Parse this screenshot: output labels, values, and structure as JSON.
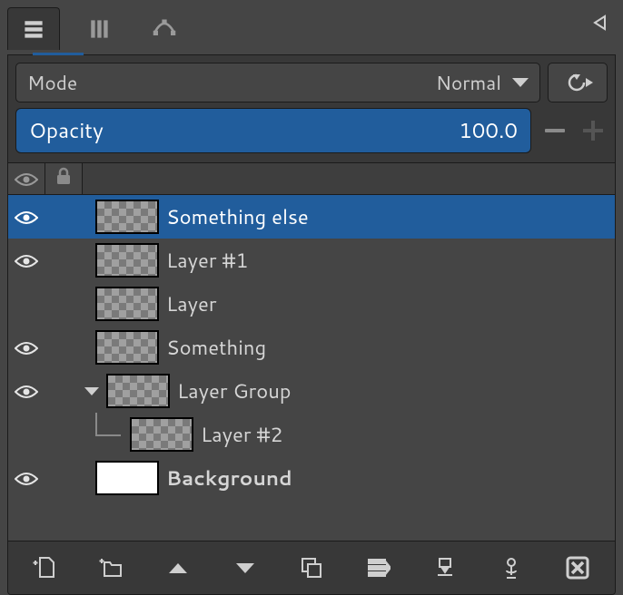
{
  "panelTabs": [
    "layers",
    "channels",
    "paths"
  ],
  "activeTab": "layers",
  "mode": {
    "label": "Mode",
    "value": "Normal"
  },
  "opacity": {
    "label": "Opacity",
    "value": "100.0"
  },
  "listHeader": {
    "visibility": "eye",
    "lock": "lock"
  },
  "layers": [
    {
      "name": "Something else",
      "visible": true,
      "selected": true,
      "thumb": "alpha",
      "indent": 0,
      "type": "layer"
    },
    {
      "name": "Layer #1",
      "visible": true,
      "selected": false,
      "thumb": "alpha",
      "indent": 0,
      "type": "layer"
    },
    {
      "name": "Layer",
      "visible": false,
      "selected": false,
      "thumb": "alpha",
      "indent": 0,
      "type": "layer"
    },
    {
      "name": "Something",
      "visible": true,
      "selected": false,
      "thumb": "alpha",
      "indent": 0,
      "type": "layer"
    },
    {
      "name": "Layer Group",
      "visible": true,
      "selected": false,
      "thumb": "alpha",
      "indent": 0,
      "type": "group",
      "expanded": true
    },
    {
      "name": "Layer #2",
      "visible": null,
      "selected": false,
      "thumb": "alpha",
      "indent": 1,
      "type": "layer"
    },
    {
      "name": "Background",
      "visible": true,
      "selected": false,
      "thumb": "white",
      "indent": 0,
      "type": "layer",
      "bold": true
    }
  ],
  "footerButtons": [
    "new-layer",
    "new-group",
    "raise-layer",
    "lower-layer",
    "duplicate-layer",
    "merge-down",
    "anchor-layer",
    "mask",
    "delete-layer"
  ]
}
